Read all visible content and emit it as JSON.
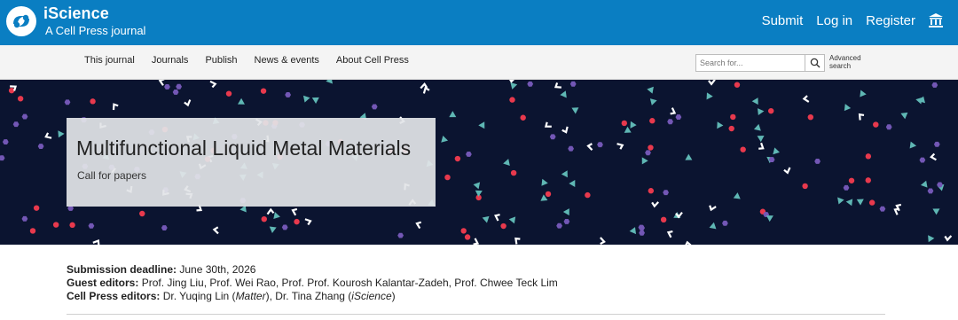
{
  "header": {
    "brand_name": "iScience",
    "brand_sub": "A Cell Press journal",
    "links": [
      "Submit",
      "Log in",
      "Register"
    ],
    "institution_icon": "institution-icon",
    "bar_color": "#0a7ec2"
  },
  "nav": {
    "items": [
      "This journal",
      "Journals",
      "Publish",
      "News & events",
      "About Cell Press"
    ],
    "search_placeholder": "Search for...",
    "search_icon": "search-icon",
    "advanced_line1": "Advanced",
    "advanced_line2": "search"
  },
  "hero": {
    "title": "Multifunctional Liquid Metal Materials",
    "subtitle": "Call for papers",
    "background_color": "#0b1430",
    "confetti_colors": [
      "#e8394d",
      "#7357b5",
      "#5fb7b4",
      "#ffffff"
    ]
  },
  "details": {
    "deadline_label": "Submission deadline:",
    "deadline_value": "June 30th, 2026",
    "guest_label": "Guest editors:",
    "guest_value": "Prof. Jing Liu, Prof. Wei Rao, Prof. Prof. Kourosh Kalantar-Zadeh, Prof. Chwee Teck Lim",
    "cp_label": "Cell Press editors:",
    "cp_part1": "Dr. Yuqing Lin (",
    "cp_journal1": "Matter",
    "cp_part2": "), Dr. Tina Zhang (",
    "cp_journal2": "iScience",
    "cp_part3": ")"
  }
}
